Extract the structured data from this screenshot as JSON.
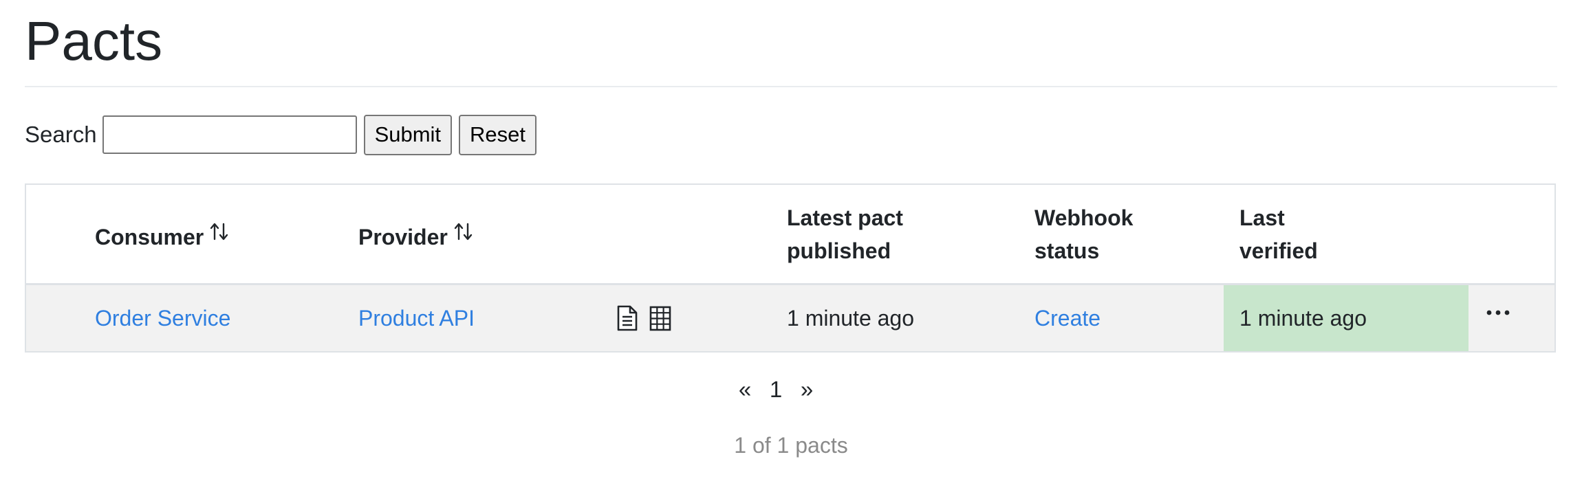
{
  "page": {
    "title": "Pacts"
  },
  "search": {
    "label": "Search",
    "value": "",
    "placeholder": "",
    "submit_label": "Submit",
    "reset_label": "Reset"
  },
  "table": {
    "headers": {
      "consumer": "Consumer",
      "provider": "Provider",
      "latest_pact_line1": "Latest pact",
      "latest_pact_line2": "published",
      "webhook_line1": "Webhook",
      "webhook_line2": "status",
      "last_verified_line1": "Last",
      "last_verified_line2": "verified"
    },
    "sort_icon": "sort-up-down-icon",
    "rows": [
      {
        "consumer": "Order Service",
        "provider": "Product API",
        "pact_icons": [
          "document-icon",
          "matrix-grid-icon"
        ],
        "latest_pact_published": "1 minute ago",
        "webhook_status": "Create",
        "last_verified": "1 minute ago",
        "menu_icon": "more-horizontal-icon"
      }
    ]
  },
  "pagination": {
    "prev": "«",
    "current": "1",
    "next": "»",
    "summary": "1 of 1 pacts"
  },
  "colors": {
    "link": "#2f7fe0",
    "verified_success_bg": "#c8e6cc",
    "row_bg": "#f2f2f2"
  }
}
